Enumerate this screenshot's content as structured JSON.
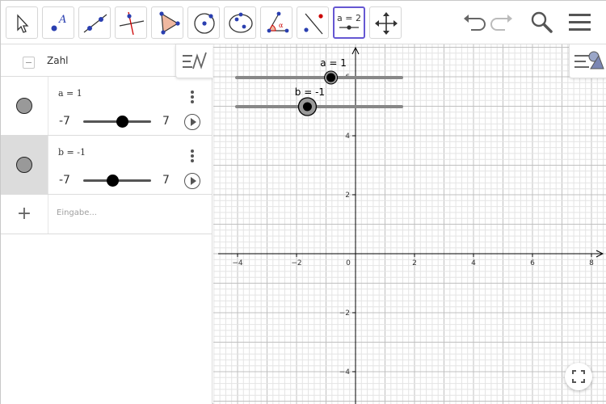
{
  "toolbar": {
    "tools": [
      {
        "name": "move-tool",
        "icon": "arrow-pointer-icon"
      },
      {
        "name": "point-tool",
        "icon": "point-icon"
      },
      {
        "name": "line-tool",
        "icon": "line-through-points-icon"
      },
      {
        "name": "perpendicular-line-tool",
        "icon": "perpendicular-icon"
      },
      {
        "name": "polygon-tool",
        "icon": "polygon-icon"
      },
      {
        "name": "circle-tool",
        "icon": "circle-center-point-icon"
      },
      {
        "name": "ellipse-tool",
        "icon": "ellipse-icon"
      },
      {
        "name": "angle-tool",
        "icon": "angle-icon"
      },
      {
        "name": "reflect-tool",
        "icon": "reflect-about-line-icon"
      },
      {
        "name": "slider-tool",
        "icon": "slider-icon",
        "label": "a = 2",
        "selected": true
      },
      {
        "name": "move-graphics-view-tool",
        "icon": "move-view-icon"
      }
    ],
    "right_buttons": [
      "undo-icon",
      "redo-icon",
      "search-icon",
      "menu-icon"
    ]
  },
  "algebra": {
    "group_label": "Zahl",
    "rows": [
      {
        "definition": "a = 1",
        "min": "-7",
        "max": "7",
        "value": 1,
        "slider_min": -7,
        "slider_max": 7,
        "active": false
      },
      {
        "definition": "b = -1",
        "min": "-7",
        "max": "7",
        "value": -1,
        "slider_min": -7,
        "slider_max": 7,
        "active": true
      }
    ],
    "input_placeholder": "Eingabe..."
  },
  "graphics": {
    "x_ticks": [
      "−4",
      "−2",
      "0",
      "2",
      "4",
      "6",
      "8"
    ],
    "y_ticks": [
      "6",
      "4",
      "2",
      "−2",
      "−4"
    ],
    "x_tick_values": [
      -4,
      -2,
      0,
      2,
      4,
      6,
      8
    ],
    "y_tick_values": [
      6,
      4,
      2,
      -2,
      -4
    ],
    "sliders": [
      {
        "label": "a = 1",
        "value": 1,
        "min": -7,
        "max": 7,
        "highlighted": false
      },
      {
        "label": "b = -1",
        "value": -1,
        "min": -7,
        "max": 7,
        "highlighted": true
      }
    ],
    "colors": {
      "axis": "#000000",
      "major_grid": "#c0c0c0",
      "minor_grid": "#e4e4e4",
      "slider_line": "#888888",
      "accent": "#6557d2"
    }
  }
}
